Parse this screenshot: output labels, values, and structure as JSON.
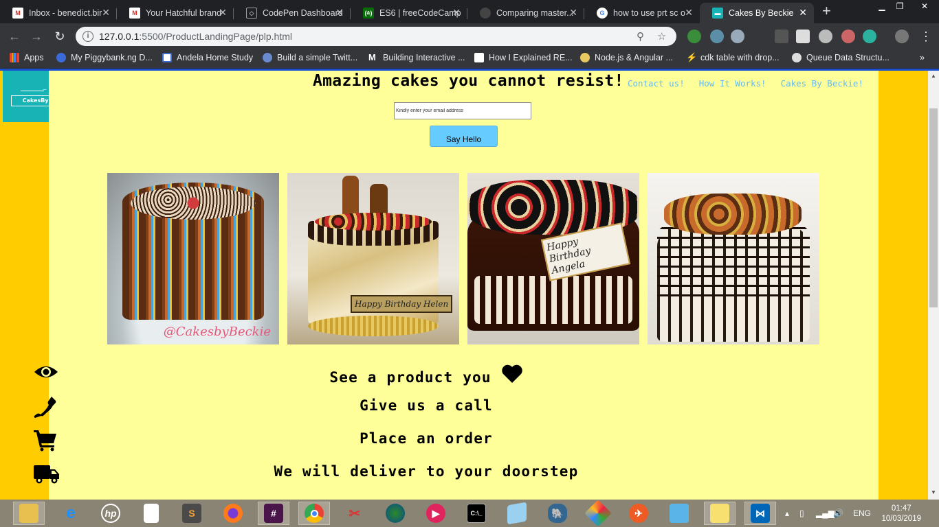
{
  "browser": {
    "tabs": [
      {
        "title": "Inbox - benedict.bir",
        "icon": "gmail-icon",
        "color": "#d93025"
      },
      {
        "title": "Your Hatchful brand",
        "icon": "gmail-icon",
        "color": "#d93025"
      },
      {
        "title": "CodePen Dashboard",
        "icon": "codepen-icon",
        "color": "#555555"
      },
      {
        "title": "ES6 | freeCodeCamp",
        "icon": "freecodecamp-icon",
        "color": "#0a6b0a"
      },
      {
        "title": "Comparing master...",
        "icon": "github-icon",
        "color": "#444444"
      },
      {
        "title": "how to use prt sc o",
        "icon": "google-icon",
        "color": "#4285f4"
      },
      {
        "title": "Cakes By Beckie",
        "icon": "cake-site-icon",
        "color": "#17b3b5"
      }
    ],
    "url_host": "127.0.0.1",
    "url_path": ":5500/ProductLandingPage/plp.html",
    "bookmarks": [
      {
        "label": "Apps",
        "icon": "apps-grid-icon"
      },
      {
        "label": "My Piggybank.ng D...",
        "icon": "piggybank-icon"
      },
      {
        "label": "Andela Home Study",
        "icon": "andela-icon"
      },
      {
        "label": "Build a simple Twitt...",
        "icon": "bookmark-site-icon"
      },
      {
        "label": "Building Interactive ...",
        "icon": "medium-icon"
      },
      {
        "label": "How I Explained RE...",
        "icon": "bookmark-site-icon"
      },
      {
        "label": "Node.js & Angular ...",
        "icon": "bookmark-site-icon"
      },
      {
        "label": "cdk table with drop...",
        "icon": "bookmark-site-icon"
      },
      {
        "label": "Queue Data Structu...",
        "icon": "bookmark-site-icon"
      }
    ]
  },
  "page": {
    "logo_text": "CakesByBeckie",
    "headline": "Amazing cakes you cannot resist!",
    "nav": [
      "Contact us!",
      "How It Works!",
      "Cakes By Beckie!"
    ],
    "email_placeholder": "Kindly enter your email address",
    "button_label": "Say Hello",
    "cake_signature": "@CakesbyBeckie",
    "cake2_plaque": "Happy Birthday Helen",
    "cake3_plaque": "Happy Birthday Angela",
    "steps": [
      {
        "icon": "eye-icon",
        "text": "See a product you"
      },
      {
        "icon": "phone-icon",
        "text": "Give us a call"
      },
      {
        "icon": "cart-icon",
        "text": "Place an order"
      },
      {
        "icon": "truck-icon",
        "text": "We will deliver to your doorstep"
      }
    ]
  },
  "taskbar": {
    "language": "ENG",
    "time": "01:47",
    "date": "10/03/2019"
  },
  "colors": {
    "side_margin": "#ffcc00",
    "page_bg": "#ffff99",
    "logo_bg": "#17b3b5",
    "nav_link": "#66bbee",
    "button_bg": "#66ccff"
  }
}
